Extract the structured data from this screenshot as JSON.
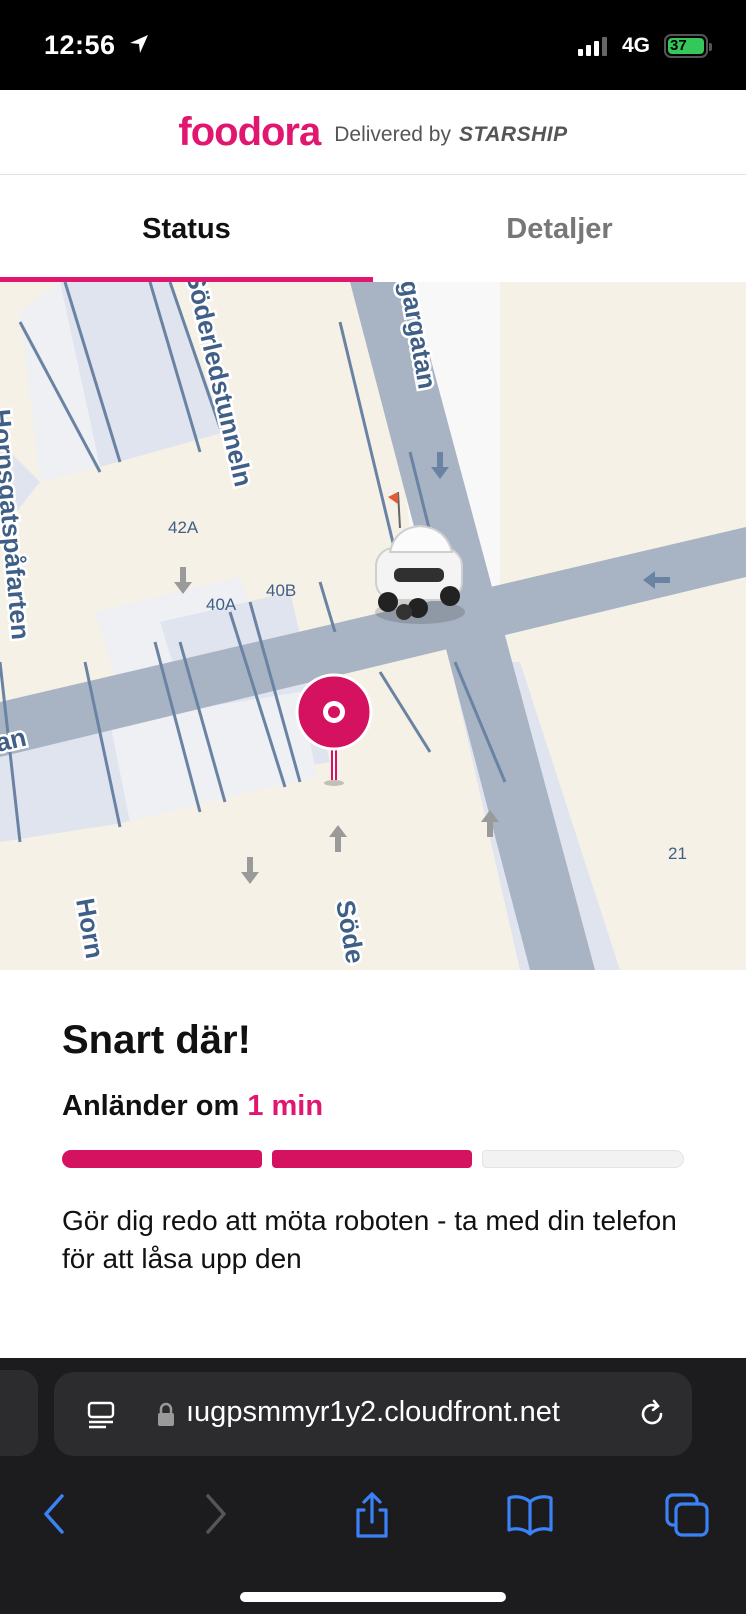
{
  "status_bar": {
    "time": "12:56",
    "network": "4G",
    "battery": "37",
    "icons": [
      "location-arrow-icon",
      "signal-bars-icon",
      "battery-charging-icon"
    ]
  },
  "header": {
    "logo": "foodora",
    "delivered_by": "Delivered by",
    "partner": "STARSHIP"
  },
  "tabs": [
    {
      "label": "Status",
      "active": true
    },
    {
      "label": "Detaljer",
      "active": false
    }
  ],
  "map": {
    "street_labels": [
      "Söderledstunneln",
      "Hornsgatspåfarten",
      "gargatan",
      "an",
      "Horn",
      "Söde"
    ],
    "address_numbers": [
      "42A",
      "40A",
      "40B",
      "21"
    ],
    "icons": [
      "delivery-robot-icon",
      "destination-pin-icon"
    ]
  },
  "card": {
    "title": "Snart där!",
    "eta_label": "Anländer om",
    "eta_value": "1 min",
    "progress": {
      "completed_steps": 2,
      "total_steps": 3
    },
    "instruction": "Gör dig redo att möta roboten - ta med din telefon för att låsa upp den"
  },
  "colors": {
    "brand": "#e0166f",
    "road": "#a8b4c4",
    "land": "#f6f1e7"
  },
  "browser": {
    "url": "ıugpsmmyr1y2.cloudfront.net",
    "icons": [
      "reader-icon",
      "lock-icon",
      "reload-icon",
      "back-icon",
      "forward-icon",
      "share-icon",
      "bookmarks-icon",
      "tabs-icon"
    ]
  }
}
